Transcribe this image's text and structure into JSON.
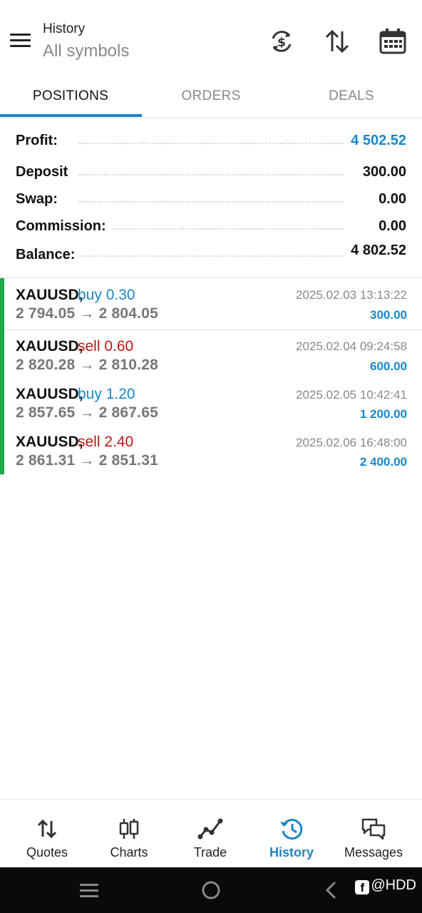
{
  "header": {
    "title": "History",
    "subtitle": "All symbols",
    "icons": [
      "currency-sync-icon",
      "sort-icon",
      "calendar-icon"
    ]
  },
  "tabs": [
    {
      "label": "POSITIONS",
      "active": true
    },
    {
      "label": "ORDERS",
      "active": false
    },
    {
      "label": "DEALS",
      "active": false
    }
  ],
  "summary": {
    "profit": {
      "label": "Profit:",
      "value": "4 502.52"
    },
    "deposit": {
      "label": "Deposit",
      "value": "300.00"
    },
    "swap": {
      "label": "Swap:",
      "value": "0.00"
    },
    "commission": {
      "label": "Commission:",
      "value": "0.00"
    },
    "balance": {
      "label": "Balance:",
      "value": "4 802.52"
    }
  },
  "positions": [
    {
      "symbol": "XAUUSD,",
      "direction": "buy 0.30",
      "type": "buy",
      "prices": "2 794.05 → 2 804.05",
      "time": "2025.02.03 13:13:22",
      "profit": "300.00"
    },
    {
      "symbol": "XAUUSD,",
      "direction": "sell 0.60",
      "type": "sell",
      "prices": "2 820.28 → 2 810.28",
      "time": "2025.02.04 09:24:58",
      "profit": "600.00"
    },
    {
      "symbol": "XAUUSD,",
      "direction": "buy 1.20",
      "type": "buy",
      "prices": "2 857.65 → 2 867.65",
      "time": "2025.02.05 10:42:41",
      "profit": "1 200.00"
    },
    {
      "symbol": "XAUUSD,",
      "direction": "sell 2.40",
      "type": "sell",
      "prices": "2 861.31 → 2 851.31",
      "time": "2025.02.06 16:48:00",
      "profit": "2 400.00"
    }
  ],
  "bottom_nav": [
    {
      "label": "Quotes",
      "icon": "quotes-icon",
      "active": false
    },
    {
      "label": "Charts",
      "icon": "charts-icon",
      "active": false
    },
    {
      "label": "Trade",
      "icon": "trade-icon",
      "active": false
    },
    {
      "label": "History",
      "icon": "history-icon",
      "active": true
    },
    {
      "label": "Messages",
      "icon": "messages-icon",
      "active": false
    }
  ],
  "watermark": "@HDD",
  "colors": {
    "accent": "#1a86c8",
    "sell": "#c01515",
    "position_bar": "#1ba84a"
  }
}
